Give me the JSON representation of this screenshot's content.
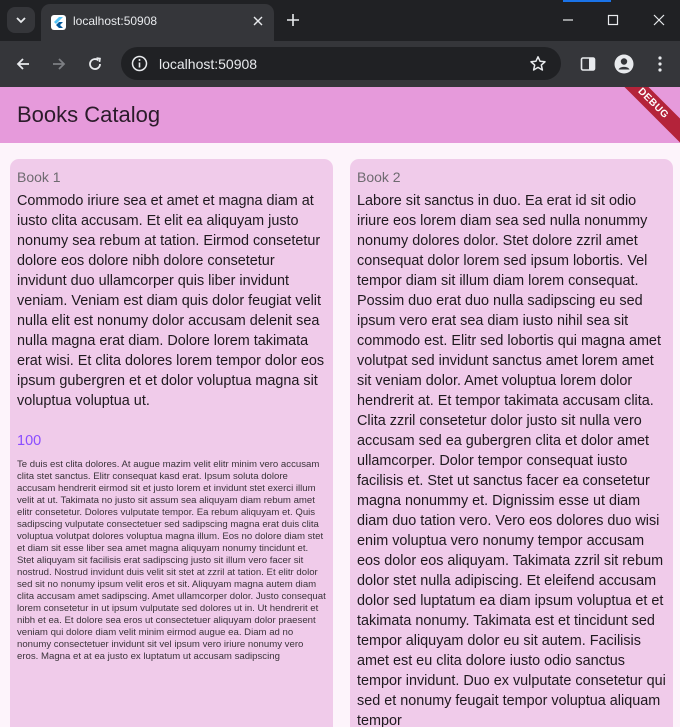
{
  "browser": {
    "tab_title": "localhost:50908",
    "url": "localhost:50908"
  },
  "app": {
    "title": "Books Catalog",
    "debug_banner": "DEBUG"
  },
  "books": [
    {
      "title": "Book 1",
      "body": "Commodo iriure sea et amet et magna diam at iusto clita accusam. Et elit ea aliquyam justo nonumy sea rebum at tation. Eirmod consetetur dolore eos dolore nibh dolore consetetur invidunt duo ullamcorper quis liber invidunt veniam. Veniam est diam quis dolor feugiat velit nulla elit est nonumy dolor accusam delenit sea nulla magna erat diam. Dolore lorem takimata erat wisi. Et clita dolores lorem tempor dolor eos ipsum gubergren et et dolor voluptua magna sit voluptua voluptua ut.",
      "price": "100",
      "description": "Te duis est clita dolores. At augue mazim velit elitr minim vero accusam clita stet sanctus. Elitr consequat kasd erat. Ipsum soluta dolore accusam hendrerit eirmod sit et justo lorem et invidunt stet exerci illum velit at ut. Takimata no justo sit assum sea aliquyam diam rebum amet elitr consetetur. Dolores vulputate tempor. Ea rebum aliquyam et. Quis sadipscing vulputate consectetuer sed sadipscing magna erat duis clita voluptua volutpat dolores voluptua magna illum. Eos no dolore diam stet et diam sit esse liber sea amet magna aliquyam nonumy tincidunt et. Stet aliquyam sit facilisis erat sadipscing justo sit illum vero facer sit nostrud. Nostrud invidunt duis velit sit stet at zzril at tation. Et elitr dolor sed sit no nonumy ipsum velit eros et sit. Aliquyam magna autem diam clita accusam amet sadipscing. Amet ullamcorper dolor. Justo consequat lorem consetetur in ut ipsum vulputate sed dolores ut in. Ut hendrerit et nibh et ea. Et dolore sea eros ut consectetuer aliquyam dolor praesent veniam qui dolore diam velit minim eirmod augue ea. Diam ad no nonumy consectetuer invidunt sit vel ipsum vero iriure nonumy vero eros. Magna et at ea justo ex luptatum ut accusam sadipscing"
    },
    {
      "title": "Book 2",
      "body": "Labore sit sanctus in duo. Ea erat id sit odio iriure eos lorem diam sea sed nulla nonummy nonumy dolores dolor. Stet dolore zzril amet consequat dolor lorem sed ipsum lobortis. Vel tempor diam sit illum diam lorem consequat. Possim duo erat duo nulla sadipscing eu sed ipsum vero erat sea diam iusto nihil sea sit commodo est. Elitr sed lobortis qui magna amet volutpat sed invidunt sanctus amet lorem amet sit veniam dolor. Amet voluptua lorem dolor hendrerit at. Et tempor takimata accusam clita. Clita zzril consetetur dolor justo sit nulla vero accusam sed ea gubergren clita et dolor amet ullamcorper. Dolor tempor consequat iusto facilisis et. Stet ut sanctus facer ea consetetur magna nonummy et. Dignissim esse ut diam diam duo tation vero. Vero eos dolores duo wisi enim voluptua vero nonumy tempor accusam eos dolor eos aliquyam. Takimata zzril sit rebum dolor stet nulla adipiscing. Et eleifend accusam dolor sed luptatum ea diam ipsum voluptua et et takimata nonumy. Takimata est et tincidunt sed tempor aliquyam dolor eu sit autem. Facilisis amet est eu clita dolore iusto odio sanctus tempor invidunt. Duo ex vulputate consetetur qui sed et nonumy feugait tempor voluptua aliquam tempor"
    }
  ],
  "colors": {
    "appbar": "#e69adb",
    "card": "#f0cbea",
    "price": "#8a4dff",
    "debug_banner": "#b4233a"
  }
}
